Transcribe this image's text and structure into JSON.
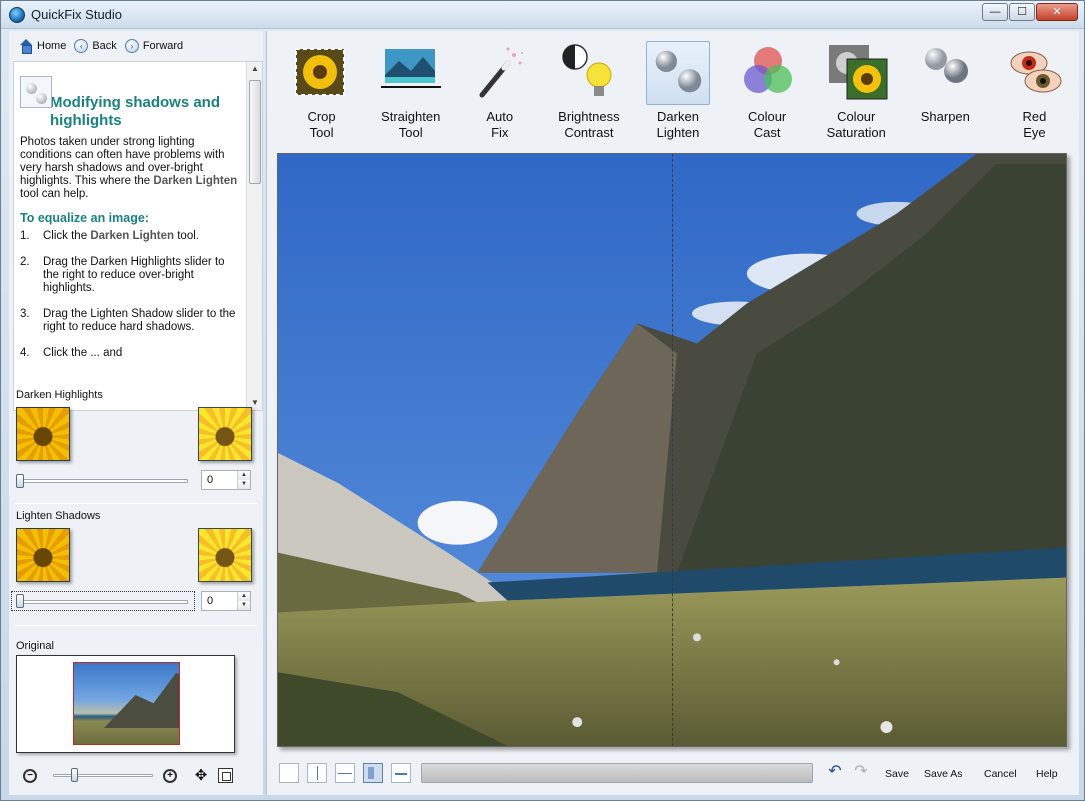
{
  "window": {
    "title": "QuickFix Studio",
    "minimize": "—",
    "maximize": "☐",
    "close": "✕"
  },
  "nav": {
    "home": "Home",
    "back": "Back",
    "forward": "Forward"
  },
  "help": {
    "title": "Modifying shadows and highlights",
    "intro": "Photos taken under strong lighting conditions can often have problems with very harsh shadows and over-bright highlights. This where the",
    "intro_tool": "Darken Lighten",
    "intro_end": "tool can help.",
    "subtitle": "To equalize an image:",
    "steps": [
      {
        "n": "1.",
        "pre": "Click the",
        "bold": "Darken Lighten",
        "post": "tool."
      },
      {
        "n": "2.",
        "pre": "Drag the Darken Highlights slider to the right to reduce over-bright highlights.",
        "bold": "",
        "post": ""
      },
      {
        "n": "3.",
        "pre": "Drag the Lighten Shadow slider to the right to reduce hard shadows.",
        "bold": "",
        "post": ""
      },
      {
        "n": "4.",
        "pre": "Click the ... and",
        "bold": "",
        "post": ""
      }
    ]
  },
  "darken": {
    "label": "Darken Highlights",
    "value": "0",
    "level": 0
  },
  "lighten": {
    "label": "Lighten Shadows",
    "value": "0",
    "level": 0
  },
  "original": {
    "label": "Original"
  },
  "zoom": {
    "level": 0.2
  },
  "tools": [
    {
      "line1": "Crop",
      "line2": "Tool",
      "icon": "crop-icon"
    },
    {
      "line1": "Straighten",
      "line2": "Tool",
      "icon": "straighten-icon"
    },
    {
      "line1": "Auto",
      "line2": "Fix",
      "icon": "magic-wand-icon"
    },
    {
      "line1": "Brightness",
      "line2": "Contrast",
      "icon": "lightbulb-icon"
    },
    {
      "line1": "Darken",
      "line2": "Lighten",
      "icon": "spheres-icon"
    },
    {
      "line1": "Colour",
      "line2": "Cast",
      "icon": "rgb-circles-icon"
    },
    {
      "line1": "Colour",
      "line2": "Saturation",
      "icon": "saturation-icon"
    },
    {
      "line1": "Sharpen",
      "line2": "",
      "icon": "sharpen-spheres-icon"
    },
    {
      "line1": "Red",
      "line2": "Eye",
      "icon": "red-eye-icon"
    }
  ],
  "active_tool": "Darken Lighten",
  "footer": {
    "save": "Save",
    "save_as": "Save As",
    "cancel": "Cancel",
    "help": "Help"
  },
  "colors": {
    "accent_teal": "#1d8080",
    "selection": "#cfe0f2",
    "progress": "#c9c9c9"
  }
}
